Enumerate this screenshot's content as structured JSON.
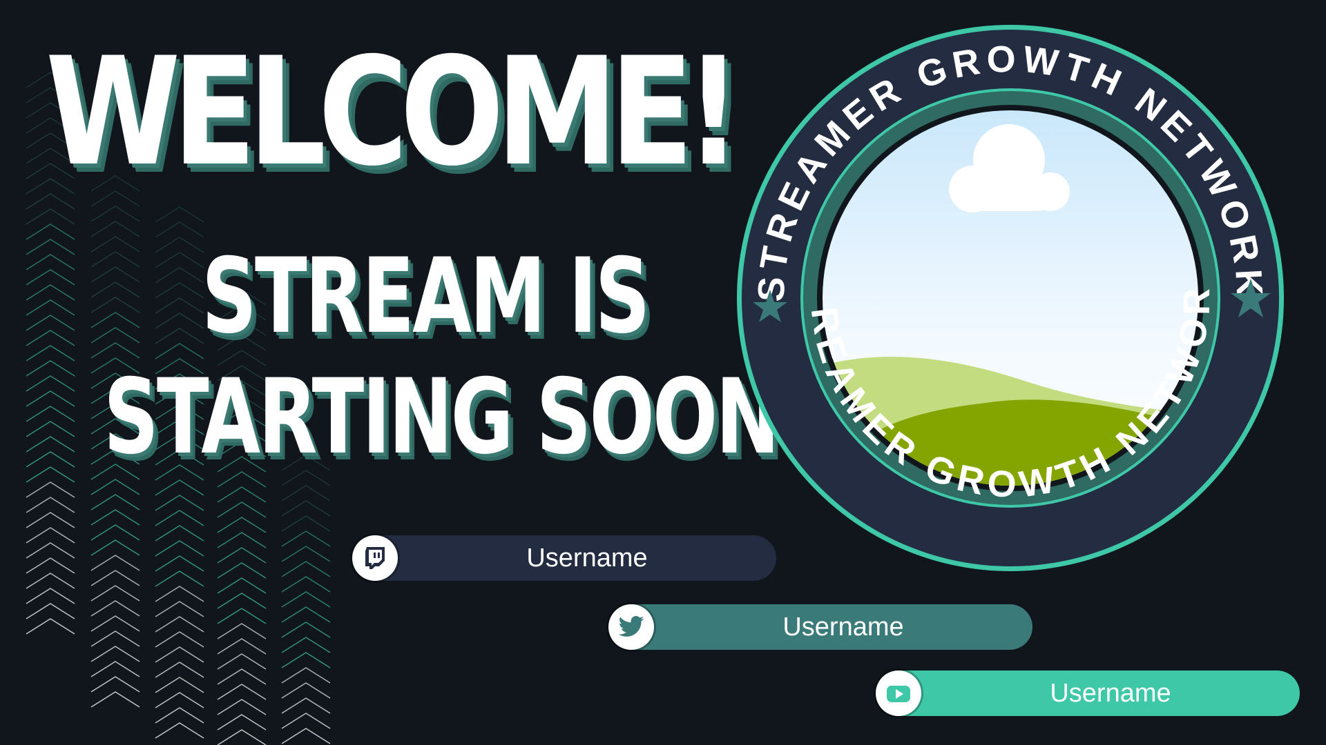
{
  "headline": {
    "welcome": "WELCOME!",
    "line1": "STREAM IS",
    "line2": "STARTING SOON!"
  },
  "badge": {
    "ring_text_top": "STREAMER GROWTH NETWORK",
    "ring_text_bottom": "STREAMER GROWTH NETWORK"
  },
  "socials": [
    {
      "platform_icon": "twitch-icon",
      "label": "Username"
    },
    {
      "platform_icon": "twitter-icon",
      "label": "Username"
    },
    {
      "platform_icon": "youtube-icon",
      "label": "Username"
    }
  ],
  "colors": {
    "background": "#11161d",
    "teal_dark": "#2f6a63",
    "teal_mid": "#3a7a78",
    "teal_bright": "#3ec8a8",
    "navy": "#232c40",
    "white": "#ffffff"
  }
}
